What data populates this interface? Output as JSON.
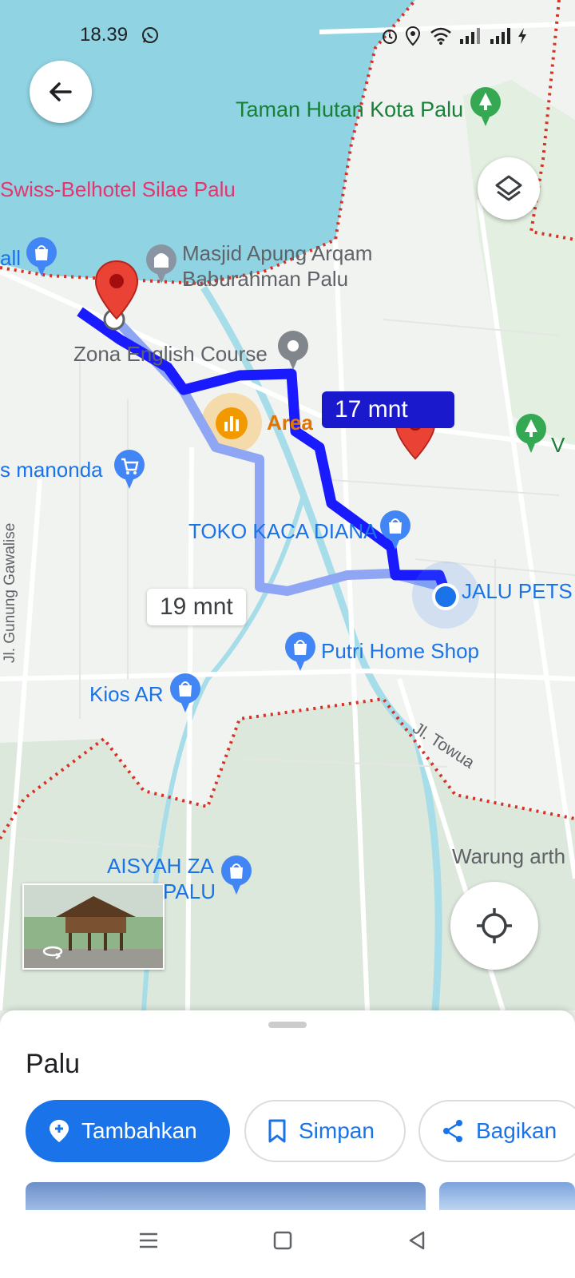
{
  "status_bar": {
    "time": "18.39"
  },
  "map": {
    "labels": {
      "taman_hutan": "Taman Hutan Kota Palu",
      "swiss_belhotel": "Swiss-Belhotel Silae Palu",
      "mall_fragment": "all",
      "masjid_line1": "Masjid Apung Arqam",
      "masjid_line2": "Baburahman Palu",
      "zona_english": "Zona English Course",
      "area": "Area",
      "manonda": "s manonda",
      "toko_kaca": "TOKO KACA DIANA",
      "jalu_pets": "JALU PETS",
      "putri_home": "Putri Home Shop",
      "kios_ar": "Kios AR",
      "jl_towua": "Jl. Towua",
      "jl_gunung": "Jl. Gunung Gawalise",
      "warung": "Warung arth",
      "aisyah_line1": "AISYAH ZA",
      "aisyah_line2": "PALU",
      "v_fragment": "V"
    },
    "route_primary_time": "17 mnt",
    "route_alt_time": "19 mnt"
  },
  "sheet": {
    "title": "Palu",
    "buttons": {
      "add": "Tambahkan",
      "save": "Simpan",
      "share": "Bagikan"
    }
  },
  "colors": {
    "accent": "#1a73e8",
    "route": "#1a1aff",
    "water": "#90d3e3"
  }
}
